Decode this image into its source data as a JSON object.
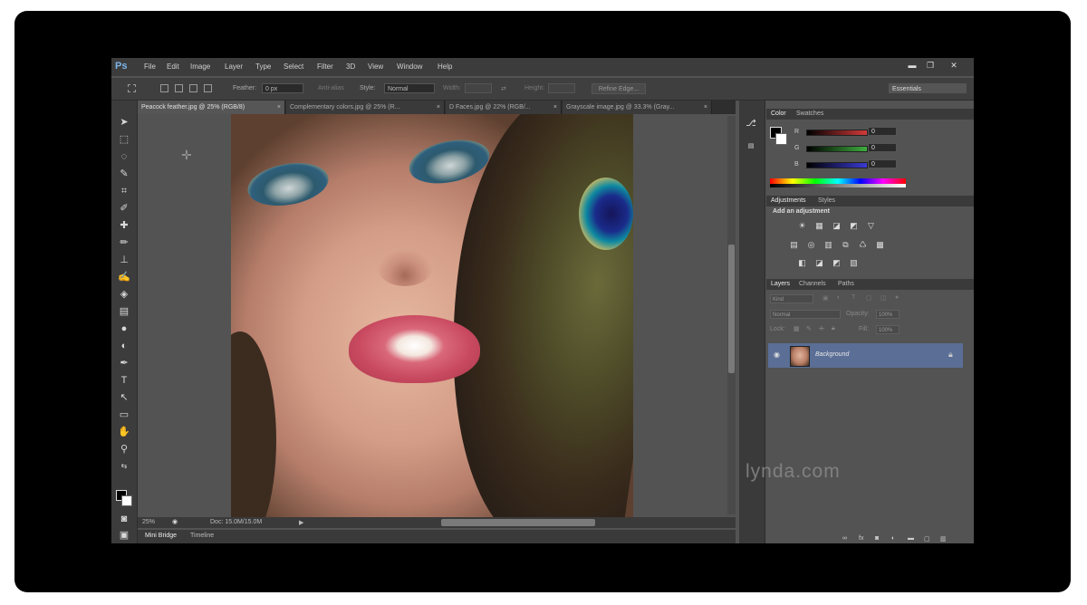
{
  "app": {
    "logo": "Ps",
    "menu": [
      "File",
      "Edit",
      "Image",
      "Layer",
      "Type",
      "Select",
      "Filter",
      "3D",
      "View",
      "Window",
      "Help"
    ],
    "window_buttons": [
      "▬",
      "❐",
      "✕"
    ]
  },
  "options": {
    "feather_label": "Feather:",
    "feather_value": "0 px",
    "antialias_label": "Anti-alias",
    "style_label": "Style:",
    "style_value": "Normal",
    "width_label": "Width:",
    "height_label": "Height:",
    "refine_edge": "Refine Edge...",
    "workspace": "Essentials"
  },
  "tabs": [
    {
      "label": "Peacock feather.jpg @ 25% (RGB/8)",
      "close": "×"
    },
    {
      "label": "Complementary colors.jpg @ 25% (R...",
      "close": "×"
    },
    {
      "label": "D Faces.jpg @ 22% (RGB/...",
      "close": "×"
    },
    {
      "label": "Grayscale image.jpg @ 33.3% (Gray...",
      "close": "×"
    }
  ],
  "status": {
    "zoom": "25%",
    "doc": "Doc: 15.0M/15.0M",
    "arrow": "▶"
  },
  "bottom_tabs": [
    "Mini Bridge",
    "Timeline"
  ],
  "color_panel": {
    "tabs": [
      "Color",
      "Swatches"
    ],
    "channels": [
      {
        "label": "R",
        "value": "0",
        "color": "#d43a3a"
      },
      {
        "label": "G",
        "value": "0",
        "color": "#3fae3f"
      },
      {
        "label": "B",
        "value": "0",
        "color": "#3a3ad4"
      }
    ]
  },
  "adjustments_panel": {
    "tabs": [
      "Adjustments",
      "Styles"
    ],
    "title": "Add an adjustment",
    "row1": [
      "☀",
      "▦",
      "◪",
      "◩",
      "▽"
    ],
    "row2": [
      "▤",
      "◎",
      "▥",
      "⧉",
      "♺",
      "▩"
    ],
    "row3": [
      "◧",
      "◪",
      "◩",
      "▧"
    ]
  },
  "layers_panel": {
    "tabs": [
      "Layers",
      "Channels",
      "Paths"
    ],
    "kind": "Kind",
    "blend_mode": "Normal",
    "opacity_label": "Opacity:",
    "opacity_value": "100%",
    "lock_label": "Lock:",
    "fill_label": "Fill:",
    "fill_value": "100%",
    "layer_name": "Background"
  },
  "watermark": "lynda.com"
}
